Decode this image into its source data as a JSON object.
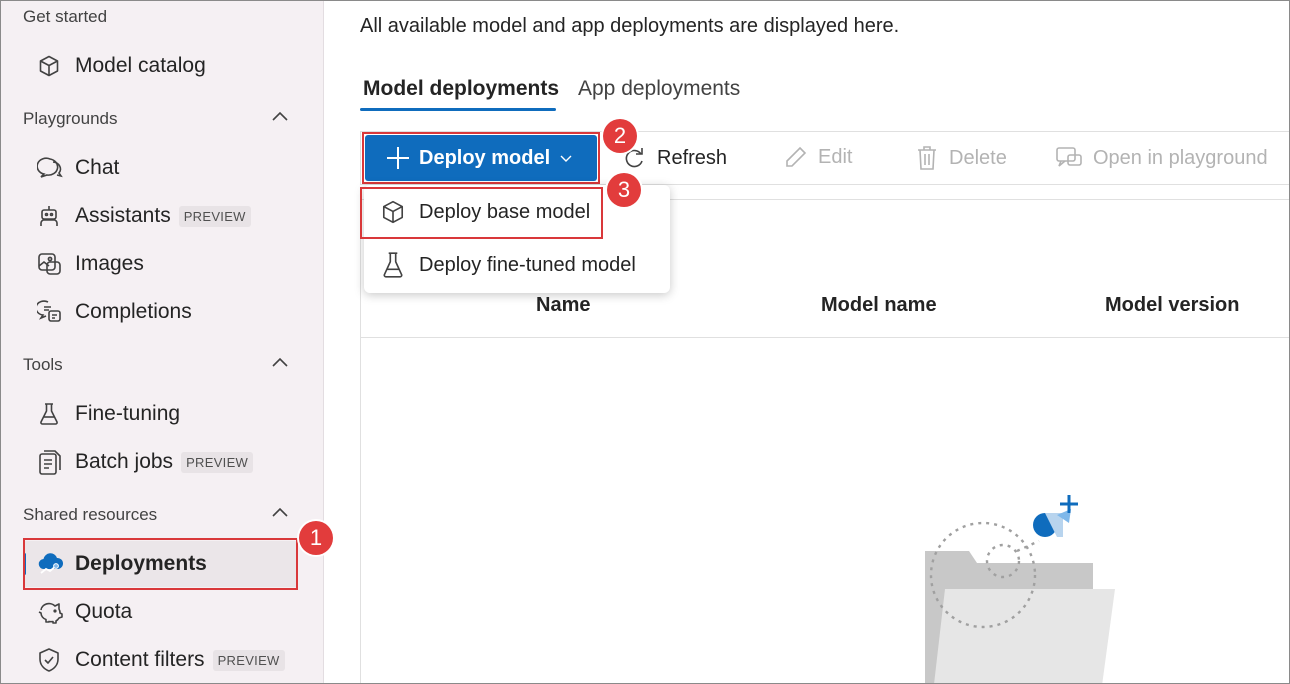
{
  "sidebar": {
    "get_started": {
      "title": "Get started",
      "items": [
        {
          "label": "Model catalog",
          "icon": "cube-icon"
        }
      ]
    },
    "playgrounds": {
      "title": "Playgrounds",
      "items": [
        {
          "label": "Chat",
          "icon": "chat-icon"
        },
        {
          "label": "Assistants",
          "icon": "bot-icon",
          "badge": "PREVIEW"
        },
        {
          "label": "Images",
          "icon": "image-icon"
        },
        {
          "label": "Completions",
          "icon": "completions-icon"
        }
      ]
    },
    "tools": {
      "title": "Tools",
      "items": [
        {
          "label": "Fine-tuning",
          "icon": "flask-icon"
        },
        {
          "label": "Batch jobs",
          "icon": "batch-icon",
          "badge": "PREVIEW"
        }
      ]
    },
    "shared": {
      "title": "Shared resources",
      "items": [
        {
          "label": "Deployments",
          "icon": "cloud-deploy-icon",
          "active": true
        },
        {
          "label": "Quota",
          "icon": "piggy-bank-icon"
        },
        {
          "label": "Content filters",
          "icon": "shield-icon",
          "badge": "PREVIEW"
        }
      ]
    }
  },
  "main": {
    "description": "All available model and app deployments are displayed here.",
    "tabs": [
      {
        "label": "Model deployments",
        "active": true
      },
      {
        "label": "App deployments",
        "active": false
      }
    ],
    "toolbar": {
      "deploy": "Deploy model",
      "refresh": "Refresh",
      "edit": "Edit",
      "delete": "Delete",
      "open_playground": "Open in playground"
    },
    "dropdown": [
      {
        "label": "Deploy base model",
        "icon": "cube-icon"
      },
      {
        "label": "Deploy fine-tuned model",
        "icon": "flask-icon"
      }
    ],
    "table_headers": [
      "Name",
      "Model name",
      "Model version"
    ]
  },
  "annotations": {
    "step1": "1",
    "step2": "2",
    "step3": "3"
  },
  "colors": {
    "accent": "#0f6cbd",
    "annotation": "#e23c3c",
    "sidebar_bg": "#f5f0f3"
  }
}
